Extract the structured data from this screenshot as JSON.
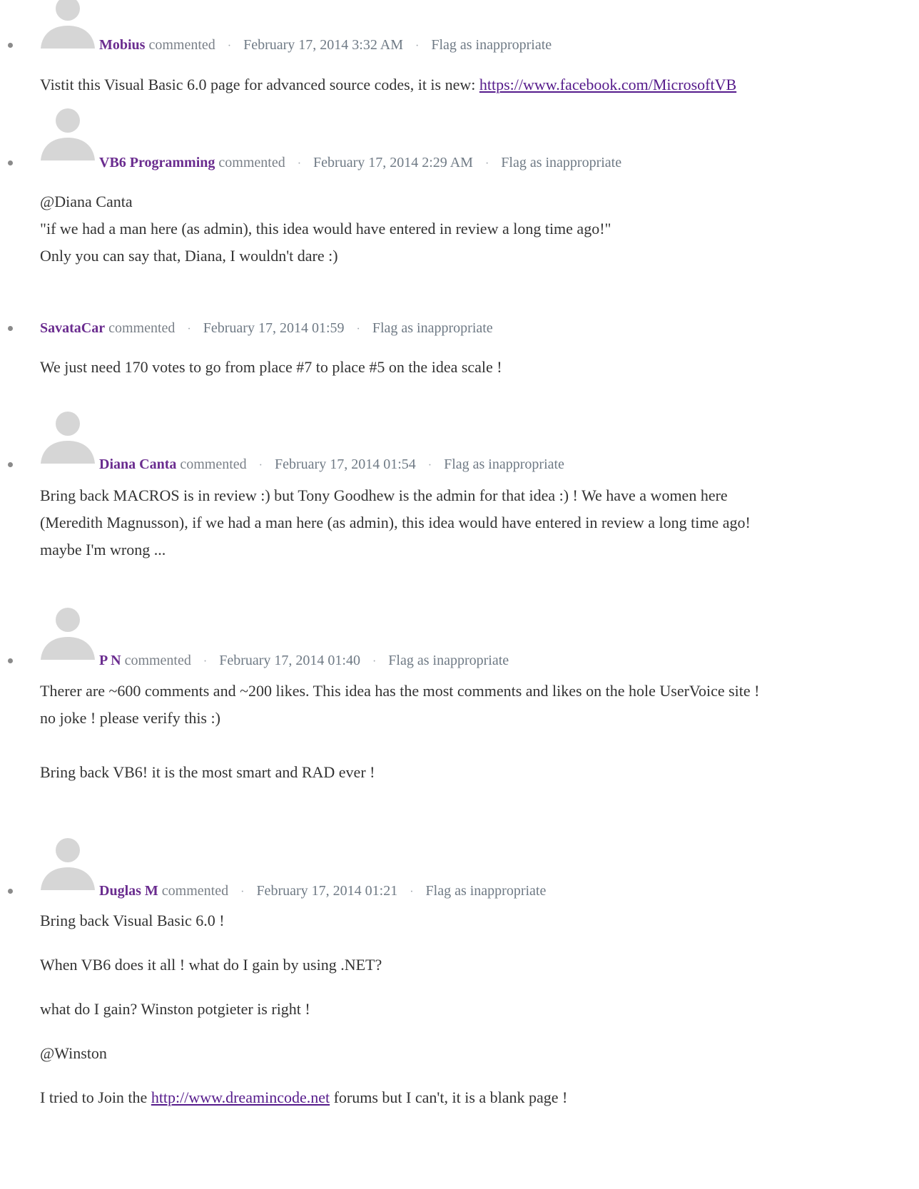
{
  "comments": [
    {
      "author": "Mobius",
      "verb": "commented",
      "sep": "·",
      "date": "February 17, 2014 3:32 AM",
      "flag": "Flag as inappropriate",
      "text_before_link": "Vistit this Visual Basic 6.0 page for advanced source codes, it is new: ",
      "link": "https://www.facebook.com/MicrosoftVB"
    },
    {
      "author": "VB6 Programming",
      "verb": "commented",
      "sep": "·",
      "date": "February 17, 2014 2:29 AM",
      "flag": "Flag as inappropriate",
      "lines": [
        "@Diana Canta",
        "\"if we had a man here (as admin), this idea would have entered in review a long time ago!\"",
        "Only you can say that, Diana, I wouldn't dare :)"
      ]
    },
    {
      "author": "SavataCar",
      "verb": "commented",
      "sep": "·",
      "date": "February 17, 2014 01:59",
      "flag": "Flag as inappropriate",
      "lines": [
        "We just need 170 votes to go from place #7 to place #5 on the idea scale !"
      ]
    },
    {
      "author": "Diana Canta",
      "verb": "commented",
      "sep": "·",
      "date": "February 17, 2014 01:54",
      "flag": "Flag as inappropriate",
      "lines": [
        "Bring back MACROS is in review :) but Tony Goodhew is the admin for that idea :) ! We have a women here",
        "(Meredith Magnusson), if we had a man here (as admin), this idea would have entered in review a long time ago!",
        "maybe I'm wrong ..."
      ]
    },
    {
      "author": "P N",
      "verb": "commented",
      "sep": "·",
      "date": "February 17, 2014 01:40",
      "flag": "Flag as inappropriate",
      "lines": [
        "Therer are ~600 comments and ~200 likes. This idea has the most comments and likes on the hole UserVoice site !",
        "no joke ! please verify this :)",
        "",
        "Bring back VB6! it is the most smart and RAD ever !"
      ]
    },
    {
      "author": "Duglas M",
      "verb": "commented",
      "sep": "·",
      "date": "February 17, 2014 01:21",
      "flag": "Flag as inappropriate",
      "lines": [
        "Bring back Visual Basic 6.0 !",
        "",
        "When VB6 does it all ! what do I gain by using .NET?",
        "",
        "what do I gain? Winston potgieter is right !",
        "",
        "@Winston",
        ""
      ],
      "last_line_before_link": "I tried to Join the ",
      "last_line_link": "http://www.dreamincode.net",
      "last_line_after_link": " forums but I can't, it is a blank page !"
    }
  ],
  "colors": {
    "author": "#6a2c8f",
    "meta": "#6f7a85",
    "body_text": "#333333",
    "link": "#551a8b",
    "avatar": "#d3d3d3"
  },
  "icons": {
    "avatar": "default-user-avatar-icon",
    "bullet": "list-bullet"
  }
}
